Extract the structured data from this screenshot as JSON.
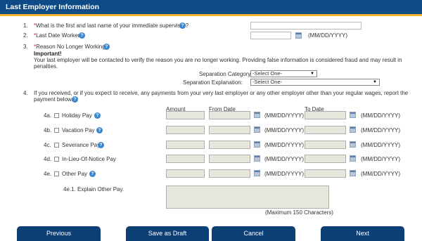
{
  "header": {
    "title": "Last Employer Information"
  },
  "q1": {
    "num": "1.",
    "text": "What is the first and last name of your immediate supervisor?",
    "value": ""
  },
  "q2": {
    "num": "2.",
    "text": "Last Date Worked",
    "hint": "(MM/DD/YYYY)",
    "value": ""
  },
  "q3": {
    "num": "3.",
    "text": "Reason No Longer Working.",
    "important": "Important!",
    "note1": "Your last employer will be contacted to verify the reason you are no longer working. Providing false information is considered fraud and may result in",
    "note2": "penalties.",
    "category_label": "Separation Category:",
    "category_value": "-Select One-",
    "explanation_label": "Separation Explanation:",
    "explanation_value": "-Select One-"
  },
  "q4": {
    "num": "4.",
    "text1": "If you received, or if you expect to receive, any payments from your very last employer or any other employer other than your regular wages, report the",
    "text2": "payment below.",
    "col_amount": "Amount",
    "col_from": "From Date",
    "col_to": "To Date",
    "date_hint": "(MM/DD/YYYY)",
    "rows": [
      {
        "num": "4a.",
        "label": "Holiday Pay",
        "help": true
      },
      {
        "num": "4b.",
        "label": "Vacation Pay",
        "help": true
      },
      {
        "num": "4c.",
        "label": "Severance Pay",
        "help": true
      },
      {
        "num": "4d.",
        "label": "In-Lieu-Of-Notice Pay",
        "help": false
      },
      {
        "num": "4e.",
        "label": "Other Pay",
        "help": true
      }
    ],
    "explain_label": "4e.1. Explain Other Pay.",
    "max_note": "(Maximum 150 Characters)"
  },
  "footer": {
    "previous": "Previous",
    "save": "Save as Draft",
    "cancel": "Cancel",
    "next": "Next"
  },
  "colors": {
    "header_bg": "#0d4a86",
    "header_accent": "#f2b32e",
    "button_bg": "#0d3f75",
    "required": "#d21f1f"
  }
}
